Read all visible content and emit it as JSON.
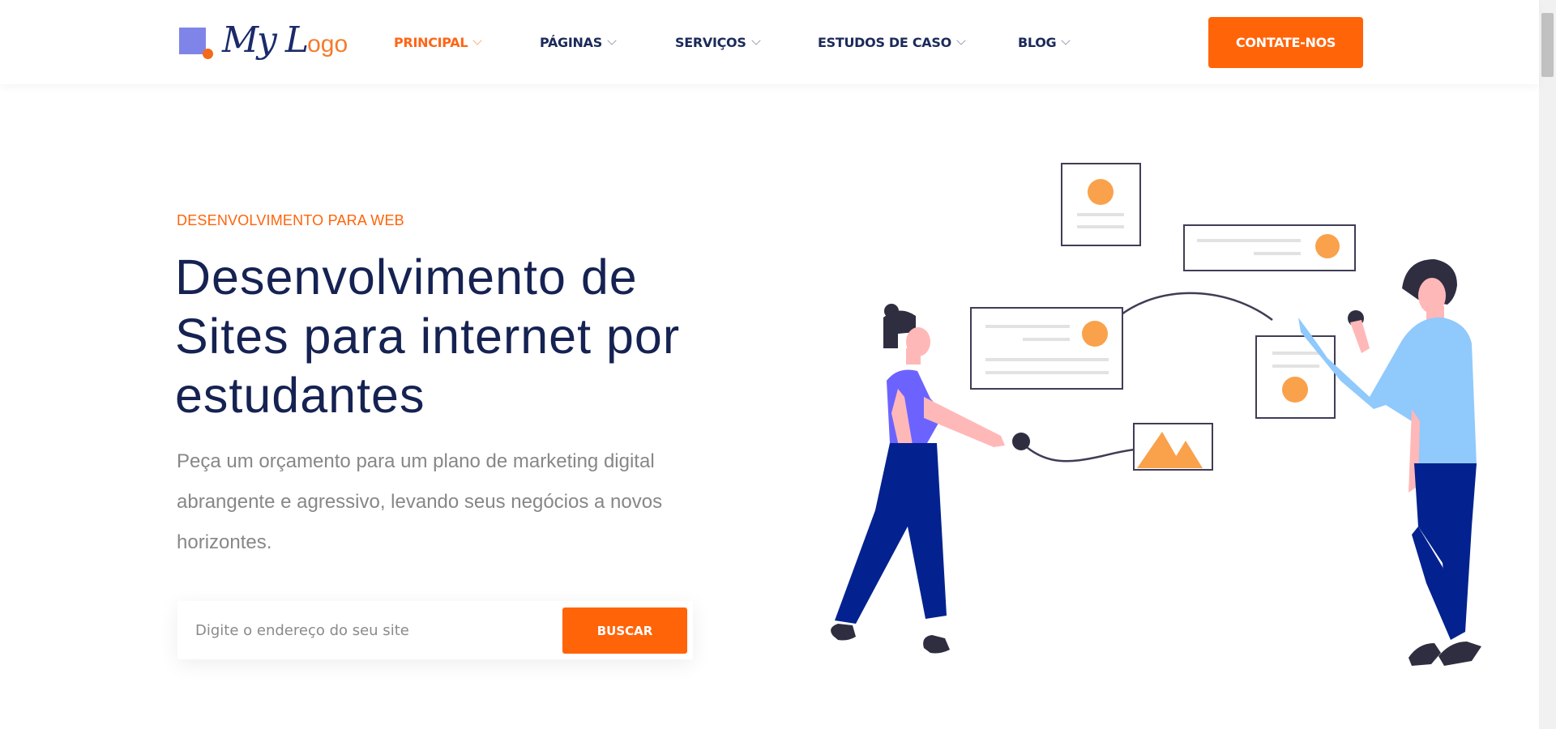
{
  "header": {
    "logo": {
      "text": "My Logo",
      "icon_name": "logo-square-dot-icon",
      "colors": {
        "square": "#7f85e8",
        "dot": "#f26a1b",
        "text": "#1b2a6b",
        "accent": "#f57b2a"
      }
    },
    "nav": [
      {
        "label": "PRINCIPAL",
        "active": true
      },
      {
        "label": "PÁGINAS",
        "active": false
      },
      {
        "label": "SERVIÇOS",
        "active": false
      },
      {
        "label": "ESTUDOS DE CASO",
        "active": false
      },
      {
        "label": "BLOG",
        "active": false
      }
    ],
    "cta_label": "CONTATE-NOS"
  },
  "hero": {
    "eyebrow": "DESENVOLVIMENTO PARA WEB",
    "title": "Desenvolvimento de Sites para internet por estudantes",
    "description": "Peça um orçamento para um plano de marketing digital abrangente e agressivo, levando seus negócios a novos horizontes.",
    "search": {
      "placeholder": "Digite o endereço do seu site",
      "button_label": "BUSCAR"
    }
  },
  "illustration": {
    "icon_name": "two-people-connecting-cards-illustration"
  },
  "colors": {
    "accent": "#ff6409",
    "heading": "#152252",
    "body_text": "#878787",
    "nav_text": "#1b2a5a"
  }
}
